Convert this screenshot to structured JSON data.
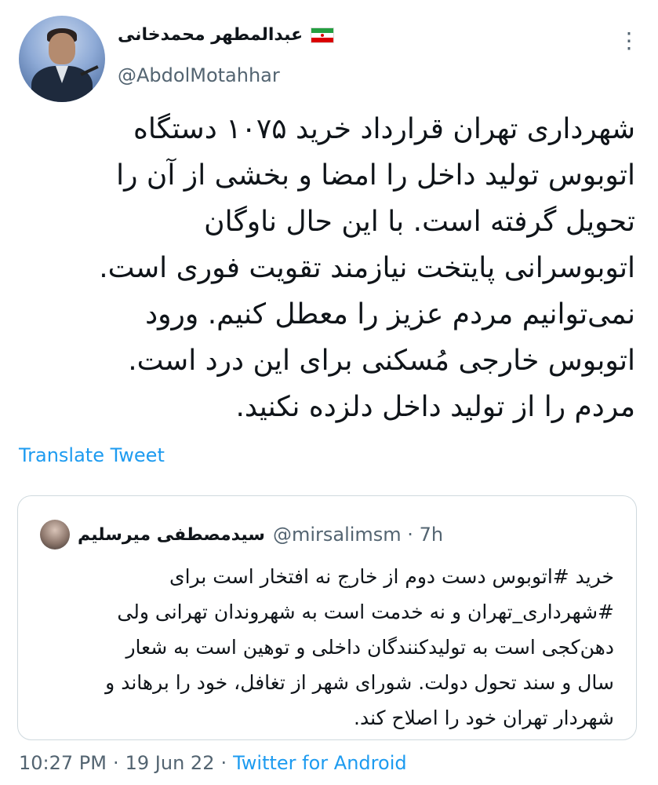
{
  "author": {
    "name": "عبدالمطهر محمدخانی",
    "handle": "@AbdolMotahhar",
    "flag_icon": "iran-flag-icon"
  },
  "tweet": {
    "lines": [
      "شهرداری تهران قرارداد خرید ۱۰۷۵ دستگاه",
      "اتوبوس تولید داخل را امضا و بخشی از آن را",
      "تحویل گرفته است. با این حال ناوگان",
      "اتوبوسرانی پایتخت نیازمند تقویت فوری است.",
      "نمی‌توانیم مردم عزیز را معطل کنیم. ورود",
      "اتوبوس خارجی مُسکنی برای این درد است.",
      "مردم را از تولید داخل دلزده نکنید."
    ],
    "translate_label": "Translate Tweet"
  },
  "quote": {
    "name": "سیدمصطفی میرسلیم",
    "handle_time": "@mirsalimsm · 7h",
    "lines": [
      "خرید #اتوبوس دست دوم از خارج نه افتخار است برای",
      "#شهرداری_تهران و نه خدمت است به شهروندان تهرانی ولی",
      "دهن‌کجی است به تولیدکنندگان داخلی و توهین است به شعار",
      "سال و سند تحول دولت. شورای شهر از تغافل، خود را برهاند و",
      "شهردار تهران خود را اصلاح کند."
    ]
  },
  "footer": {
    "time": "10:27 PM",
    "sep1": "·",
    "date": "19 Jun 22",
    "sep2": "·",
    "source": "Twitter for Android"
  },
  "colors": {
    "link": "#1d9bf0",
    "muted": "#536471",
    "text": "#0f1419",
    "border": "#cfd9de"
  },
  "icons": {
    "more": "more-options-icon"
  }
}
